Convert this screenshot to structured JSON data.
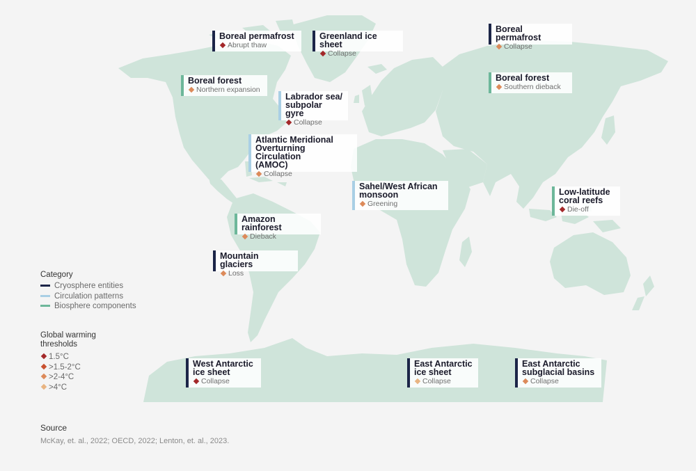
{
  "colors": {
    "land": "#cfe4da",
    "cryosphere": "#1c2548",
    "circulation": "#a9cfe5",
    "biosphere": "#6db79a",
    "t1_5": "#a3282a",
    "t1_5_2": "#c8502f",
    "t2_4": "#dc8a5a",
    "t4": "#e8b482"
  },
  "labels": [
    {
      "title": "Boreal permafrost",
      "status": "Abrupt thaw",
      "category": "cryosphere",
      "threshold": "t1_5"
    },
    {
      "title": "Greenland ice sheet",
      "status": "Collapse",
      "category": "cryosphere",
      "threshold": "t1_5"
    },
    {
      "title": "Boreal permafrost",
      "status": "Collapse",
      "category": "cryosphere",
      "threshold": "t2_4"
    },
    {
      "title": "Boreal forest",
      "status": "Northern expansion",
      "category": "biosphere",
      "threshold": "t2_4"
    },
    {
      "title": "Labrador sea/\nsubpolar gyre",
      "status": "Collapse",
      "category": "circulation",
      "threshold": "t1_5"
    },
    {
      "title": "Boreal forest",
      "status": "Southern dieback",
      "category": "biosphere",
      "threshold": "t2_4"
    },
    {
      "title": "Atlantic Meridional\nOverturning Circulation\n(AMOC)",
      "status": "Collapse",
      "category": "circulation",
      "threshold": "t2_4"
    },
    {
      "title": "Sahel/West African\nmonsoon",
      "status": "Greening",
      "category": "circulation",
      "threshold": "t2_4"
    },
    {
      "title": "Low-latitude\ncoral reefs",
      "status": "Die-off",
      "category": "biosphere",
      "threshold": "t1_5"
    },
    {
      "title": "Amazon rainforest",
      "status": "Dieback",
      "category": "biosphere",
      "threshold": "t2_4"
    },
    {
      "title": "Mountain glaciers",
      "status": "Loss",
      "category": "cryosphere",
      "threshold": "t2_4"
    },
    {
      "title": "West Antarctic\nice sheet",
      "status": "Collapse",
      "category": "cryosphere",
      "threshold": "t1_5"
    },
    {
      "title": "East Antarctic\nice sheet",
      "status": "Collapse",
      "category": "cryosphere",
      "threshold": "t4"
    },
    {
      "title": "East Antarctic\nsubglacial basins",
      "status": "Collapse",
      "category": "cryosphere",
      "threshold": "t2_4"
    }
  ],
  "legend": {
    "category_title": "Category",
    "categories": [
      {
        "label": "Cryosphere entities",
        "key": "cryosphere"
      },
      {
        "label": "Circulation patterns",
        "key": "circulation"
      },
      {
        "label": "Biosphere components",
        "key": "biosphere"
      }
    ],
    "threshold_title": "Global warming\nthresholds",
    "thresholds": [
      {
        "label": "1.5°C",
        "key": "t1_5"
      },
      {
        "label": ">1.5-2°C",
        "key": "t1_5_2"
      },
      {
        "label": ">2-4°C",
        "key": "t2_4"
      },
      {
        "label": ">4°C",
        "key": "t4"
      }
    ]
  },
  "source": {
    "title": "Source",
    "text": "McKay, et. al., 2022; OECD, 2022; Lenton, et. al., 2023."
  }
}
